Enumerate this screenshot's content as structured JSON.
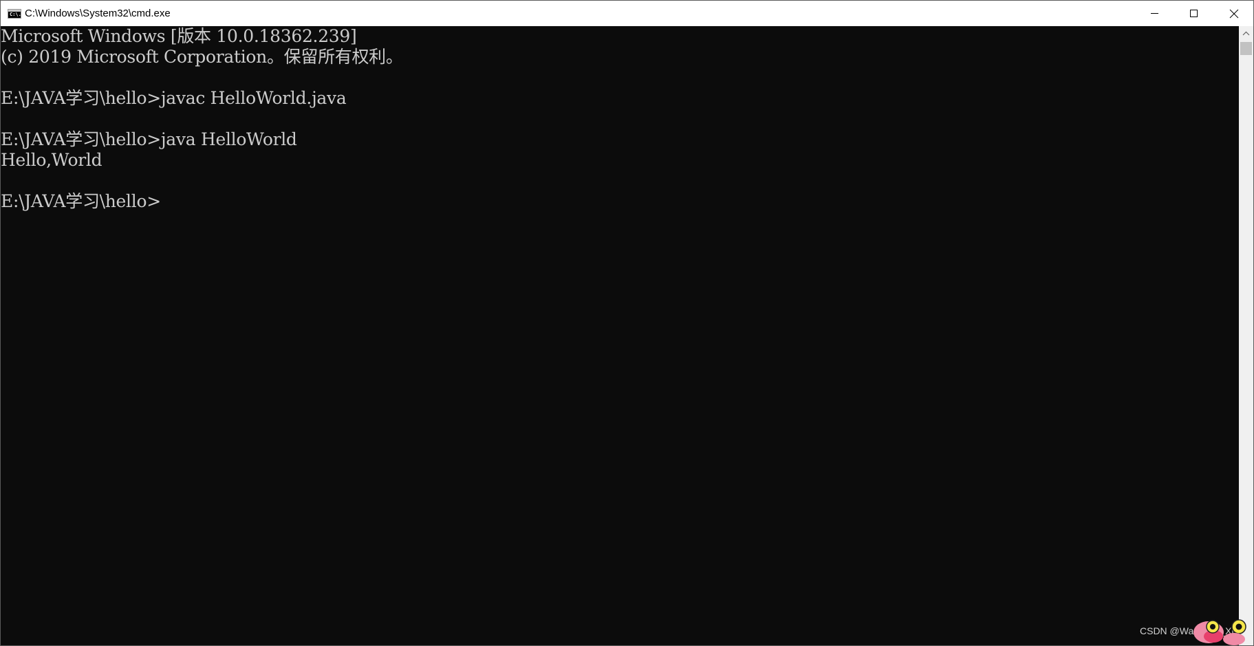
{
  "window": {
    "title": "C:\\Windows\\System32\\cmd.exe",
    "icon_label": "C:\\."
  },
  "console": {
    "lines": [
      "Microsoft Windows [版本 10.0.18362.239]",
      "(c) 2019 Microsoft Corporation。保留所有权利。",
      "",
      "E:\\JAVA学习\\hello>javac HelloWorld.java",
      "",
      "E:\\JAVA学习\\hello>java HelloWorld",
      "Hello,World",
      "",
      "E:\\JAVA学习\\hello>"
    ],
    "text_color": "#cccccc",
    "background_color": "#0c0c0c"
  },
  "watermark": {
    "text": "CSDN @WanTang_Xu"
  },
  "icons": {
    "minimize": "minimize-icon",
    "maximize": "maximize-icon",
    "close": "close-icon",
    "scroll_up": "chevron-up-icon"
  }
}
